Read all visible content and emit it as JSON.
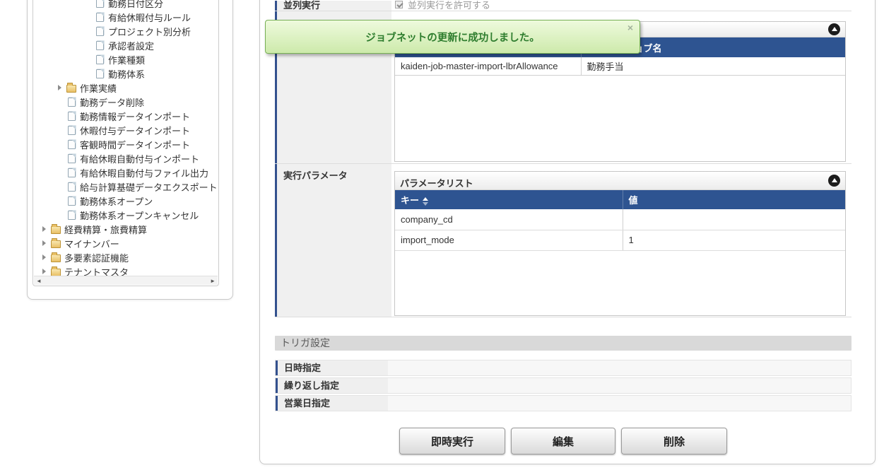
{
  "colors": {
    "table_header_blue": "#2e5491",
    "label_accent_navy": "#33518e",
    "toast_text_green": "#2e7d2e",
    "toast_border_green": "#77b055",
    "toast_bg_green": "#dff3c4",
    "section_bar_gray": "#d9d9d9"
  },
  "toast": {
    "message": "ジョブネットの更新に成功しました。",
    "close": "×"
  },
  "sidebar": {
    "items": [
      {
        "label": "勤務日付区分",
        "level": 3,
        "type": "doc"
      },
      {
        "label": "有給休暇付与ルール",
        "level": 3,
        "type": "doc"
      },
      {
        "label": "プロジェクト別分析",
        "level": 3,
        "type": "doc"
      },
      {
        "label": "承認者設定",
        "level": 3,
        "type": "doc"
      },
      {
        "label": "作業種類",
        "level": 3,
        "type": "doc"
      },
      {
        "label": "勤務体系",
        "level": 3,
        "type": "doc"
      },
      {
        "label": "作業実績",
        "level": 2,
        "type": "folder"
      },
      {
        "label": "勤務データ削除",
        "level": 2,
        "type": "doc"
      },
      {
        "label": "勤務情報データインポート",
        "level": 2,
        "type": "doc"
      },
      {
        "label": "休暇付与データインポート",
        "level": 2,
        "type": "doc"
      },
      {
        "label": "客観時間データインポート",
        "level": 2,
        "type": "doc"
      },
      {
        "label": "有給休暇自動付与インポート",
        "level": 2,
        "type": "doc"
      },
      {
        "label": "有給休暇自動付与ファイル出力",
        "level": 2,
        "type": "doc"
      },
      {
        "label": "給与計算基礎データエクスポート",
        "level": 2,
        "type": "doc"
      },
      {
        "label": "勤務体系オープン",
        "level": 2,
        "type": "doc"
      },
      {
        "label": "勤務体系オープンキャンセル",
        "level": 2,
        "type": "doc"
      },
      {
        "label": "経費精算・旅費精算",
        "level": 1,
        "type": "folder"
      },
      {
        "label": "マイナンバー",
        "level": 1,
        "type": "folder"
      },
      {
        "label": "多要素認証機能",
        "level": 1,
        "type": "folder"
      },
      {
        "label": "テナントマスタ",
        "level": 1,
        "type": "folder"
      }
    ],
    "scrollbar": {
      "left_arrow": "◄",
      "right_arrow": "►"
    }
  },
  "main": {
    "parallel_row": {
      "label": "並列実行",
      "checkbox_label": "並列実行を許可する",
      "checked": true
    },
    "job_panel": {
      "columns": {
        "col1": "",
        "col2": "ジョブ名"
      },
      "rows": [
        {
          "id": "kaiden-job-master-import-lbrAllowance",
          "name": "勤務手当"
        }
      ]
    },
    "param_row_label": "実行パラメータ",
    "param_panel": {
      "title": "パラメータリスト",
      "columns": {
        "key": "キー",
        "value": "値"
      },
      "rows": [
        {
          "key": "company_cd",
          "value": ""
        },
        {
          "key": "import_mode",
          "value": "1"
        }
      ]
    },
    "trigger": {
      "title": "トリガ設定",
      "rows": [
        "日時指定",
        "繰り返し指定",
        "営業日指定"
      ]
    },
    "buttons": [
      "即時実行",
      "編集",
      "削除"
    ]
  }
}
